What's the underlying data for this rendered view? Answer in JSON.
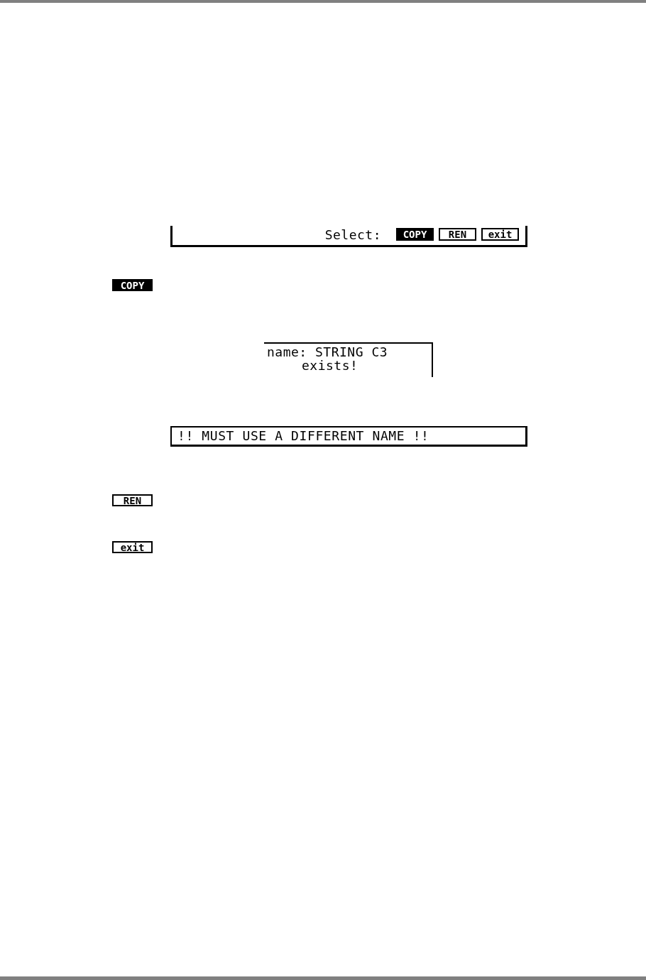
{
  "blocks": [
    {
      "kind": "select_bar",
      "label": "Select:",
      "keys": [
        {
          "label": "COPY",
          "selected": true
        },
        {
          "label": "REN",
          "selected": false
        },
        {
          "label": "exit",
          "selected": false
        }
      ]
    },
    {
      "kind": "key",
      "label": "COPY",
      "selected": true
    },
    {
      "kind": "message_box",
      "lines": [
        "name: STRING C3",
        "exists!"
      ]
    },
    {
      "kind": "alert_bar",
      "text": "!! MUST USE A DIFFERENT NAME !!"
    },
    {
      "kind": "key",
      "label": "REN",
      "selected": false
    },
    {
      "kind": "key",
      "label": "exit",
      "selected": false
    }
  ]
}
